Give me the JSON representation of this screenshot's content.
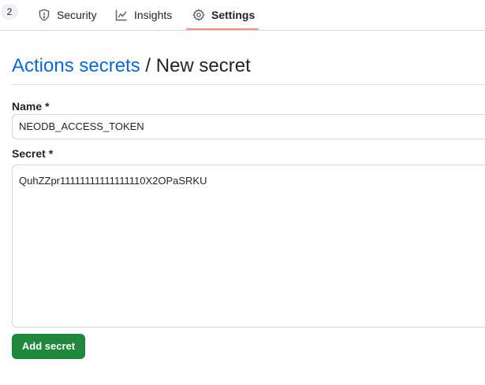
{
  "nav": {
    "counter": "2",
    "tabs": [
      {
        "label": "Security",
        "icon": "shield-icon"
      },
      {
        "label": "Insights",
        "icon": "graph-icon"
      },
      {
        "label": "Settings",
        "icon": "gear-icon",
        "selected": true
      }
    ],
    "selected_underline_color": "#fd8c73"
  },
  "header": {
    "breadcrumb_link": "Actions secrets",
    "separator": "/",
    "title": "New secret"
  },
  "form": {
    "name_label": "Name *",
    "name_value": "NEODB_ACCESS_TOKEN",
    "secret_label": "Secret *",
    "secret_value": "QuhZZpr11111111111111110X2OPaSRKU",
    "submit_label": "Add secret"
  },
  "colors": {
    "link": "#0969da",
    "primary_button": "#1f883d"
  }
}
